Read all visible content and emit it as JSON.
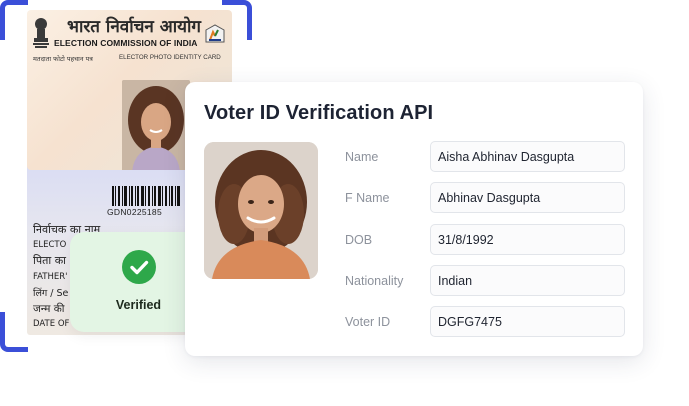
{
  "colors": {
    "accent_frame": "#3b4fd8",
    "verified_bg": "#e3f5e4",
    "verified_check": "#2ea84a",
    "label_gray": "#8d929c"
  },
  "card_front": {
    "hindi_title": "भारत निर्वाचन आयोग",
    "english_title": "ELECTION COMMISSION OF INDIA",
    "hindi_subtitle": "मतदाता फोटो पहचान पत्र",
    "english_subtitle": "ELECTOR PHOTO IDENTITY CARD"
  },
  "card_back": {
    "epic_number": "GDN0225185",
    "lines": [
      "निर्वाचक का नाम",
      "ELECTO",
      "पिता का",
      "FATHER'",
      "लिंग / Se",
      "जन्म की",
      "DATE OF B"
    ]
  },
  "badge": {
    "icon": "check-icon",
    "label": "Verified"
  },
  "panel": {
    "title": "Voter ID Verification API",
    "fields": [
      {
        "label": "Name",
        "value": "Aisha Abhinav Dasgupta"
      },
      {
        "label": "F Name",
        "value": "Abhinav Dasgupta"
      },
      {
        "label": "DOB",
        "value": "31/8/1992"
      },
      {
        "label": "Nationality",
        "value": "Indian"
      },
      {
        "label": "Voter ID",
        "value": "DGFG7475"
      }
    ]
  }
}
